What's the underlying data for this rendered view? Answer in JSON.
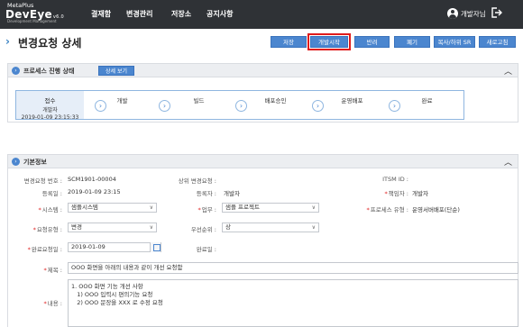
{
  "header": {
    "logo_top": "MetaPlus",
    "logo_main": "DevEye",
    "logo_version": "v6.0",
    "logo_sub": "Development Management",
    "nav": [
      "결재함",
      "변경관리",
      "저장소",
      "공지사항"
    ],
    "user_name": "개발자님",
    "icons": {
      "user": "user-icon",
      "logout": "logout-icon"
    }
  },
  "page": {
    "title": "변경요청 상세",
    "toolbar": [
      "저장",
      "개발시작",
      "반려",
      "폐기",
      "복사/하위 SR",
      "새로고침"
    ],
    "highlighted_button": "개발시작"
  },
  "process": {
    "title": "프로세스 진행 상태",
    "detail_button": "상세 보기",
    "steps": [
      {
        "name": "접수",
        "user": "개발자",
        "date": "2019-01-09 23:15:33"
      },
      {
        "name": "개발"
      },
      {
        "name": "빌드"
      },
      {
        "name": "배포승인"
      },
      {
        "name": "운영배포"
      },
      {
        "name": "완료"
      }
    ]
  },
  "basic": {
    "title": "기본정보",
    "change_no_label": "변경요청 번호 :",
    "change_no": "SCM1901-00004",
    "parent_label": "상위 변경요청 :",
    "itsm_label": "ITSM ID :",
    "reg_date_label": "등록일 :",
    "reg_date": "2019-01-09 23:15",
    "registrant_label": "등록자 :",
    "registrant": "개발자",
    "owner_label": "책임자 :",
    "owner": "개발자",
    "system_label": "시스템 :",
    "system": "샘플시스템",
    "task_label": "업무 :",
    "task": "샘플 프로젝트",
    "proc_type_label": "프로세스 유형 :",
    "proc_type": "운영서버배포(단순)",
    "req_type_label": "요청유형 :",
    "req_type": "변경",
    "priority_label": "우선순위 :",
    "priority": "상",
    "due_date_label": "완료요청일 :",
    "due_date": "2019-01-09",
    "done_date_label": "완료일 :",
    "subject_label": "제목 :",
    "subject": "OOO 화면을 아래의 내용과 같이 개선 요청함",
    "content_label": "내용 :",
    "content_lines": [
      "1. OOO 화면 기능 개선 사항",
      "   1) OOO 입력시 편의기능 요청",
      "   2) OOO 문장을 XXX 로 수정 요청"
    ]
  },
  "colors": {
    "topbar": "#2f3236",
    "accent": "#4b86cf",
    "highlight": "#e01b1b",
    "required": "#e02020"
  }
}
